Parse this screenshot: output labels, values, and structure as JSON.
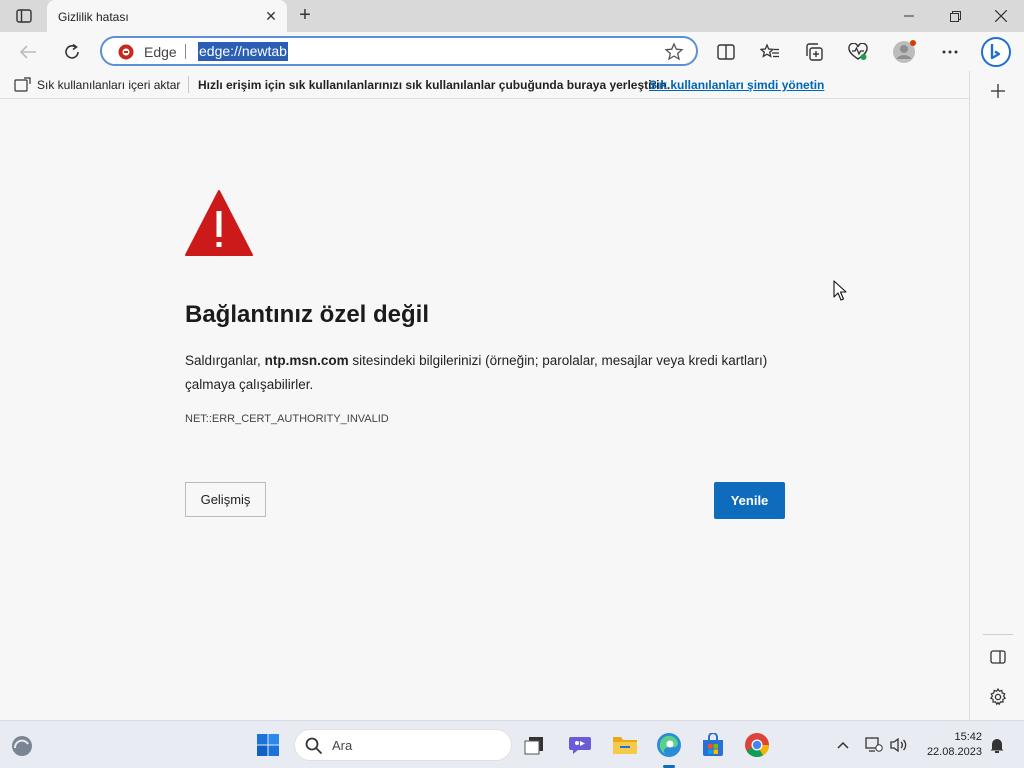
{
  "tab": {
    "title": "Gizlilik hatası"
  },
  "omnibox": {
    "site_label": "Edge",
    "url": "edge://newtab"
  },
  "favorites_bar": {
    "import_label": "Sık kullanılanları içeri aktar",
    "hint": "Hızlı erişim için sık kullanılanlarınızı sık kullanılanlar çubuğunda buraya yerleştirin.",
    "manage_link": "Sık kullanılanları şimdi yönetin"
  },
  "error_page": {
    "heading": "Bağlantınız özel değil",
    "desc_prefix": "Saldırganlar,",
    "desc_host": "ntp.msn.com",
    "desc_suffix": "sitesindeki bilgilerinizi (örneğin; parolalar, mesajlar veya kredi kartları) çalmaya çalışabilirler.",
    "error_code": "NET::ERR_CERT_AUTHORITY_INVALID",
    "advanced_button": "Gelişmiş",
    "reload_button": "Yenile"
  },
  "taskbar": {
    "search_placeholder": "Ara",
    "time": "15:42",
    "date": "22.08.2023"
  },
  "colors": {
    "accent": "#0f6cbd",
    "warning_red": "#cc1a1a",
    "link": "#0066b4"
  }
}
